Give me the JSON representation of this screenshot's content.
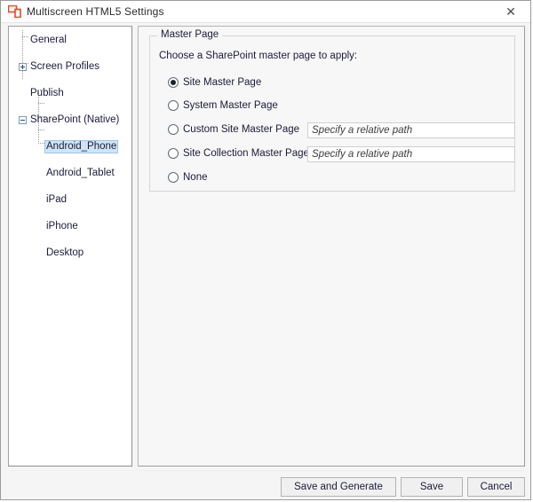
{
  "window": {
    "title": "Multiscreen HTML5 Settings",
    "icon": "multiscreen-devices-icon",
    "close_label": "✕"
  },
  "tree": {
    "nodes": [
      {
        "label": "General",
        "depth": 0,
        "expander": "none",
        "selected": false
      },
      {
        "label": "Screen Profiles",
        "depth": 0,
        "expander": "plus",
        "selected": false
      },
      {
        "label": "Publish",
        "depth": 0,
        "expander": "none",
        "selected": false
      },
      {
        "label": "SharePoint (Native)",
        "depth": 0,
        "expander": "minus",
        "selected": false
      },
      {
        "label": "Android_Phone",
        "depth": 1,
        "expander": "none",
        "selected": true
      },
      {
        "label": "Android_Tablet",
        "depth": 1,
        "expander": "none",
        "selected": false
      },
      {
        "label": "iPad",
        "depth": 1,
        "expander": "none",
        "selected": false
      },
      {
        "label": "iPhone",
        "depth": 1,
        "expander": "none",
        "selected": false
      },
      {
        "label": "Desktop",
        "depth": 1,
        "expander": "none",
        "selected": false
      }
    ]
  },
  "master_page": {
    "group_title": "Master Page",
    "intro": "Choose a SharePoint master page to apply:",
    "options": [
      {
        "label": "Site Master Page",
        "selected": true,
        "has_input": false
      },
      {
        "label": "System Master Page",
        "selected": false,
        "has_input": false
      },
      {
        "label": "Custom Site Master Page",
        "selected": false,
        "has_input": true,
        "input_value": "",
        "input_placeholder": "Specify a relative path"
      },
      {
        "label": "Site Collection Master Page",
        "selected": false,
        "has_input": true,
        "input_value": "",
        "input_placeholder": "Specify a relative path"
      },
      {
        "label": "None",
        "selected": false,
        "has_input": false
      }
    ]
  },
  "footer": {
    "save_and_generate_label": "Save and Generate",
    "save_label": "Save",
    "cancel_label": "Cancel"
  },
  "colors": {
    "icon_red": "#e8452b",
    "selection_fill": "#cfe4f7",
    "selection_border": "#9fc6e8",
    "panel_bg": "#f7f7f7",
    "window_bg": "#f5f5f5"
  }
}
